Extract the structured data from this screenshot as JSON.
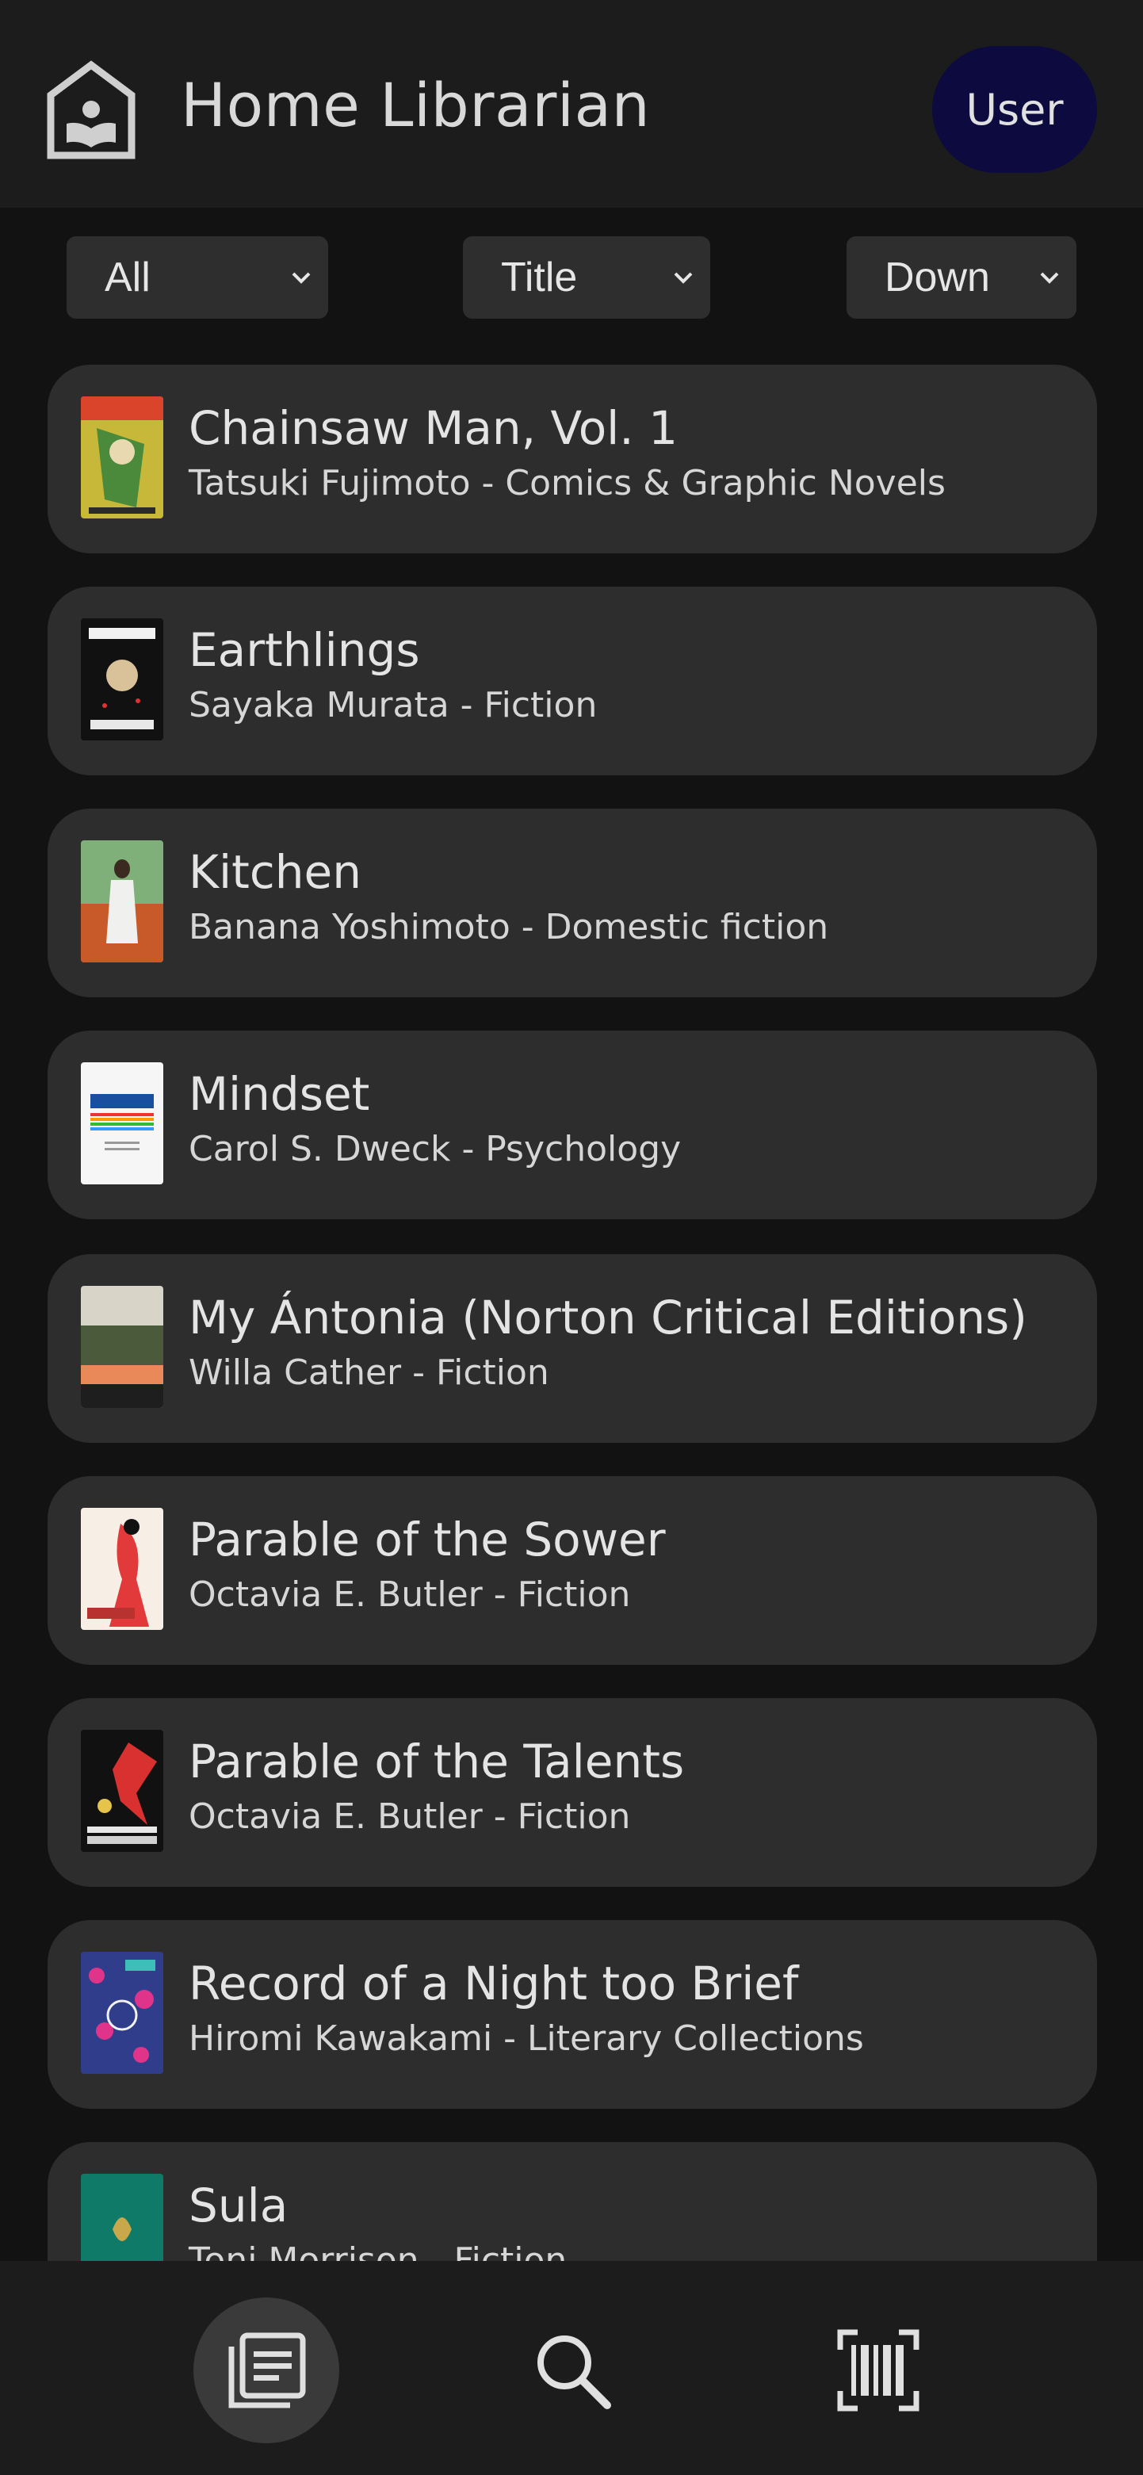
{
  "header": {
    "title": "Home Librarian",
    "user_label": "User"
  },
  "filters": {
    "category": "All",
    "sort_by": "Title",
    "order": "Down"
  },
  "books": [
    {
      "title": "Chainsaw Man, Vol. 1",
      "subtitle": "Tatsuki Fujimoto - Comics & Graphic Novels"
    },
    {
      "title": "Earthlings",
      "subtitle": "Sayaka Murata - Fiction"
    },
    {
      "title": "Kitchen",
      "subtitle": "Banana Yoshimoto - Domestic fiction"
    },
    {
      "title": "Mindset",
      "subtitle": "Carol S. Dweck - Psychology"
    },
    {
      "title": "My Ántonia (Norton Critical Editions)",
      "subtitle": "Willa Cather - Fiction"
    },
    {
      "title": "Parable of the Sower",
      "subtitle": "Octavia E. Butler - Fiction"
    },
    {
      "title": "Parable of the Talents",
      "subtitle": "Octavia E. Butler - Fiction"
    },
    {
      "title": "Record of a Night too Brief",
      "subtitle": "Hiromi Kawakami - Literary Collections"
    },
    {
      "title": "Sula",
      "subtitle": "Toni Morrison - Fiction"
    }
  ],
  "nav": {
    "library_icon": "library-list-icon",
    "search_icon": "search-icon",
    "scan_icon": "barcode-scan-icon"
  },
  "colors": {
    "background": "#121212",
    "bar": "#1c1c1c",
    "card": "#2d2d2d",
    "user_button": "#0c0a3f"
  }
}
